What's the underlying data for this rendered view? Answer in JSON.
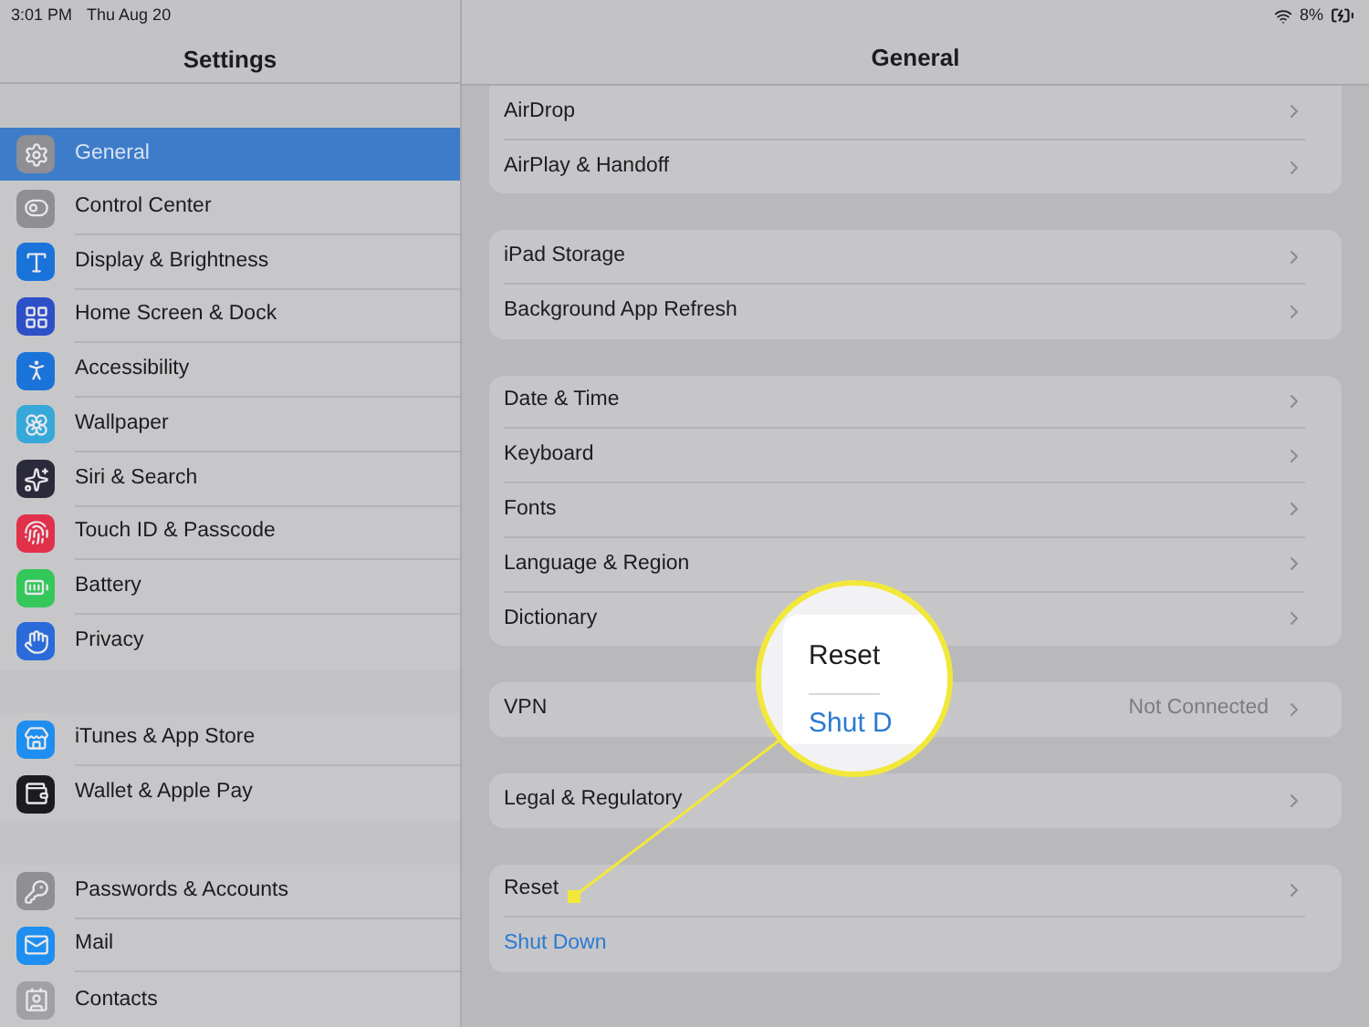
{
  "status_bar": {
    "time": "3:01 PM",
    "date": "Thu Aug 20",
    "battery": "8%"
  },
  "sidebar": {
    "title": "Settings",
    "groups": [
      [
        {
          "label": "General",
          "kind": "gear",
          "color": "#8e8e93",
          "selected": true
        },
        {
          "label": "Control Center",
          "kind": "toggles",
          "color": "#8e8e93",
          "selected": false
        },
        {
          "label": "Display & Brightness",
          "kind": "text",
          "color": "#1a73d9",
          "selected": false
        },
        {
          "label": "Home Screen & Dock",
          "kind": "grid",
          "color": "#2d50c8",
          "selected": false
        },
        {
          "label": "Accessibility",
          "kind": "person",
          "color": "#1a73d9",
          "selected": false
        },
        {
          "label": "Wallpaper",
          "kind": "flower",
          "color": "#36a8d9",
          "selected": false
        },
        {
          "label": "Siri & Search",
          "kind": "sparkle",
          "color": "#2a2a3a",
          "selected": false
        },
        {
          "label": "Touch ID & Passcode",
          "kind": "fingerprint",
          "color": "#e0304a",
          "selected": false
        },
        {
          "label": "Battery",
          "kind": "battery",
          "color": "#34c759",
          "selected": false
        },
        {
          "label": "Privacy",
          "kind": "hand",
          "color": "#2a6ad9",
          "selected": false
        }
      ],
      [
        {
          "label": "iTunes & App Store",
          "kind": "store",
          "color": "#1e8ef0",
          "selected": false
        },
        {
          "label": "Wallet & Apple Pay",
          "kind": "wallet",
          "color": "#1c1c1e",
          "selected": false
        }
      ],
      [
        {
          "label": "Passwords & Accounts",
          "kind": "key",
          "color": "#8e8e93",
          "selected": false
        },
        {
          "label": "Mail",
          "kind": "mail",
          "color": "#1e8ef0",
          "selected": false
        },
        {
          "label": "Contacts",
          "kind": "contact",
          "color": "#a0a0a6",
          "selected": false
        }
      ]
    ]
  },
  "detail": {
    "title": "General",
    "groups": [
      [
        {
          "label": "AirDrop",
          "kind": "link"
        },
        {
          "label": "AirPlay & Handoff",
          "kind": "link"
        }
      ],
      [
        {
          "label": "iPad Storage",
          "kind": "link"
        },
        {
          "label": "Background App Refresh",
          "kind": "link"
        }
      ],
      [
        {
          "label": "Date & Time",
          "kind": "link"
        },
        {
          "label": "Keyboard",
          "kind": "link"
        },
        {
          "label": "Fonts",
          "kind": "link"
        },
        {
          "label": "Language & Region",
          "kind": "link"
        },
        {
          "label": "Dictionary",
          "kind": "link"
        }
      ],
      [
        {
          "label": "VPN",
          "kind": "link",
          "value": "Not Connected"
        }
      ],
      [
        {
          "label": "Legal & Regulatory",
          "kind": "link"
        }
      ],
      [
        {
          "label": "Reset",
          "kind": "link"
        },
        {
          "label": "Shut Down",
          "kind": "action"
        }
      ]
    ]
  },
  "magnifier": {
    "title": "Reset",
    "subtitle": "Shut D"
  }
}
